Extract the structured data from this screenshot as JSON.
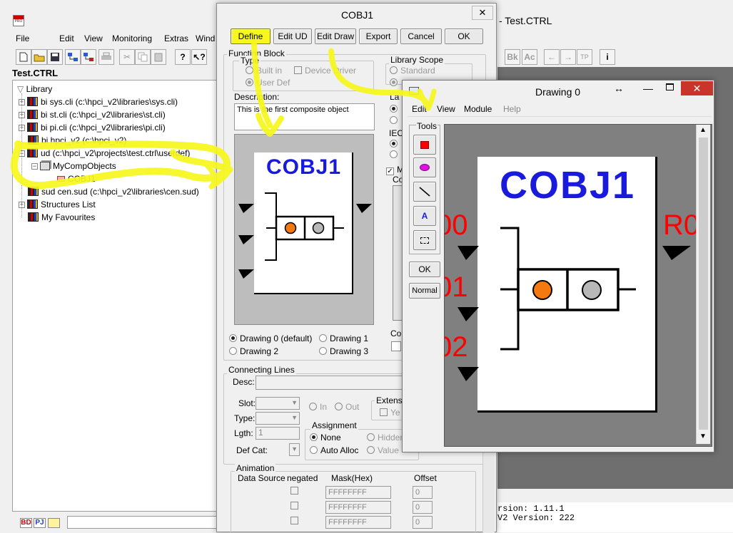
{
  "main_window": {
    "title_suffix": "i - Test.CTRL",
    "menu": [
      "File",
      "Edit",
      "View",
      "Monitoring",
      "Extras",
      "Wind"
    ],
    "toolbar_right": [
      "Bk",
      "Ac",
      "i"
    ],
    "tree_title": "Test.CTRL",
    "tree": {
      "root": "Library",
      "items": [
        "bi sys.cli (c:\\hpci_v2\\libraries\\sys.cli)",
        "bi st.cli (c:\\hpci_v2\\libraries\\st.cli)",
        "bi pi.cli (c:\\hpci_v2\\libraries\\pi.cli)",
        "bi hpci_v2 (c:\\hpci_v2)",
        "ud (c:\\hpci_v2\\projects\\test.ctrl\\userdef)",
        "MyCompObjects",
        "COBJ1",
        "sud cen.sud (c:\\hpci_v2\\libraries\\cen.sud)",
        "Structures List",
        "My Favourites"
      ]
    },
    "bottom_tabs": [
      "BD",
      "PJ"
    ],
    "console_lines": [
      "rsion: 1.11.1",
      "V2 Version: 222"
    ]
  },
  "cobj_dialog": {
    "title": "COBJ1",
    "buttons": [
      "Define",
      "Edit UD",
      "Edit Draw",
      "Export",
      "Cancel",
      "OK"
    ],
    "function_block_label": "Function Block",
    "type_label": "Type",
    "type_builtin": "Built in",
    "type_userdef": "User Def",
    "device_driver": "Device Driver",
    "library_scope_label": "Library Scope",
    "scope_standard": "Standard",
    "description_label": "Description:",
    "description_value": "This is the first composite object",
    "partial_labels": [
      "La",
      "IEC",
      "M",
      "Co",
      "Cor"
    ],
    "preview_title": "COBJ1",
    "drawing_options": [
      "Drawing 0 (default)",
      "Drawing 1",
      "Drawing 2",
      "Drawing 3"
    ],
    "connecting_lines_label": "Connecting Lines",
    "desc_label": "Desc:",
    "slot_label": "Slot:",
    "type2_label": "Type:",
    "lgth_label": "Lgth:",
    "lgth_value": "1",
    "defcat_label": "Def Cat:",
    "in_label": "In",
    "out_label": "Out",
    "extension_label": "Extensi",
    "extension_check": "Ye",
    "assignment_label": "Assignment",
    "assignment_options": [
      "None",
      "Hidden",
      "Auto Alloc",
      "Value"
    ],
    "animation_label": "Animation",
    "anim_headers": [
      "Data Source",
      "negated",
      "Mask(Hex)",
      "Offset"
    ],
    "anim_rows": [
      {
        "mask": "FFFFFFFF",
        "offset": "0"
      },
      {
        "mask": "FFFFFFFF",
        "offset": "0"
      },
      {
        "mask": "FFFFFFFF",
        "offset": "0"
      }
    ]
  },
  "drawing_window": {
    "title": "Drawing 0",
    "menu": [
      "Edit",
      "View",
      "Module",
      "Help"
    ],
    "tools_label": "Tools",
    "tool_icons": [
      "rectangle-tool-icon",
      "ellipse-tool-icon",
      "line-tool-icon",
      "text-tool-icon",
      "select-tool-icon"
    ],
    "text_tool_glyph": "A",
    "ok_label": "OK",
    "normal_label": "Normal",
    "canvas_title": "COBJ1",
    "pin_labels_left": [
      "00",
      "01",
      "02"
    ],
    "pin_label_right": "R0"
  },
  "colors": {
    "highlight": "#f7f71c",
    "cobj_blue": "#1a1adc",
    "pin_red": "#ff0000",
    "orange_led": "#f47a10",
    "grey_led": "#b8b8b8",
    "canvas_grey": "#808080",
    "close_red": "#c9352b"
  }
}
